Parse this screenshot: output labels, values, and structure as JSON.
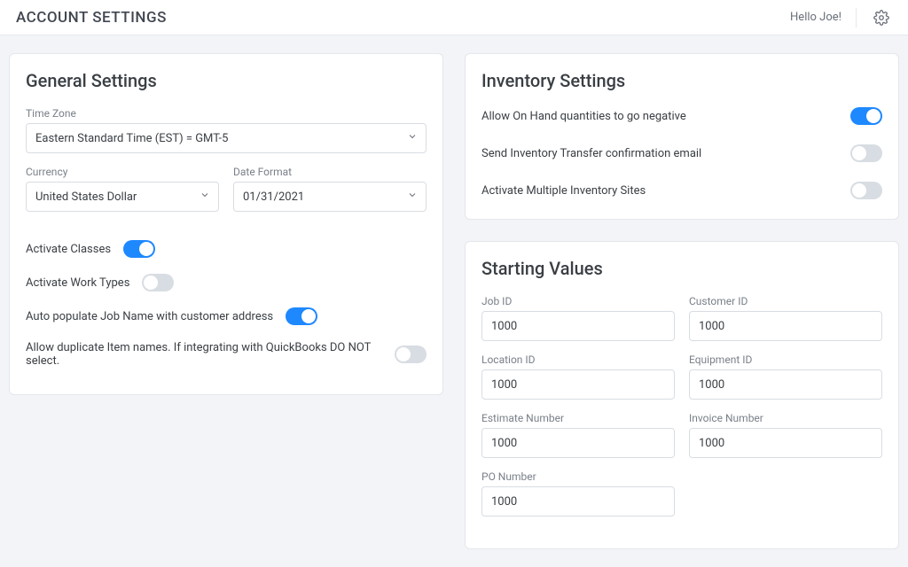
{
  "header": {
    "title": "ACCOUNT SETTINGS",
    "greeting": "Hello Joe!"
  },
  "general": {
    "title": "General Settings",
    "timezone_label": "Time Zone",
    "timezone_value": "Eastern Standard Time (EST) = GMT-5",
    "currency_label": "Currency",
    "currency_value": "United States Dollar",
    "dateformat_label": "Date Format",
    "dateformat_value": "01/31/2021",
    "toggles": {
      "activate_classes": {
        "label": "Activate Classes",
        "on": true
      },
      "activate_work_types": {
        "label": "Activate Work Types",
        "on": false
      },
      "auto_populate_job_name": {
        "label": "Auto populate Job Name with customer address",
        "on": true
      },
      "allow_dup_item_names": {
        "label": "Allow duplicate Item names. If integrating with QuickBooks DO NOT select.",
        "on": false
      }
    }
  },
  "inventory": {
    "title": "Inventory Settings",
    "toggles": {
      "allow_negative": {
        "label": "Allow On Hand quantities to go negative",
        "on": true
      },
      "send_transfer_email": {
        "label": "Send Inventory Transfer confirmation email",
        "on": false
      },
      "multiple_sites": {
        "label": "Activate Multiple Inventory Sites",
        "on": false
      }
    }
  },
  "starting": {
    "title": "Starting Values",
    "fields": {
      "job_id": {
        "label": "Job ID",
        "value": "1000"
      },
      "customer_id": {
        "label": "Customer ID",
        "value": "1000"
      },
      "location_id": {
        "label": "Location ID",
        "value": "1000"
      },
      "equipment_id": {
        "label": "Equipment ID",
        "value": "1000"
      },
      "estimate_no": {
        "label": "Estimate Number",
        "value": "1000"
      },
      "invoice_no": {
        "label": "Invoice Number",
        "value": "1000"
      },
      "po_no": {
        "label": "PO Number",
        "value": "1000"
      }
    }
  }
}
